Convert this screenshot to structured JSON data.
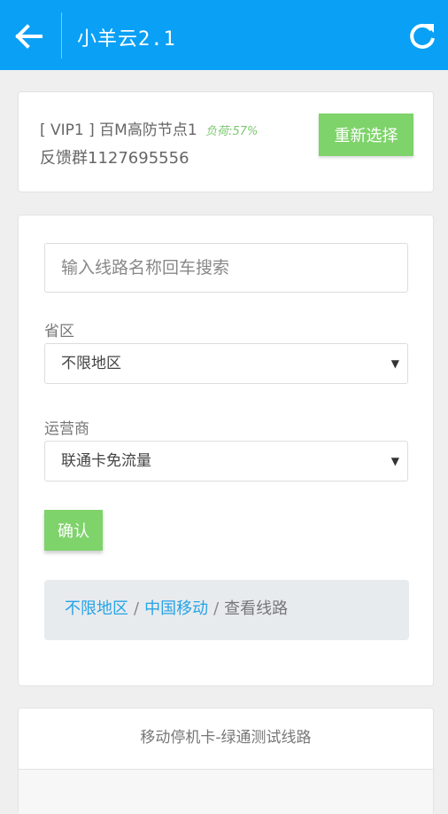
{
  "header": {
    "title": "小羊云2.1",
    "back_icon": "arrow-left-icon",
    "refresh_icon": "refresh-icon",
    "color": "#0aa0f5"
  },
  "node_card": {
    "node_name": "[ VIP1 ] 百M高防节点1",
    "load_text": "负荷:57%",
    "feedback": "反馈群1127695556",
    "reselect_label": "重新选择"
  },
  "filter": {
    "search_placeholder": "输入线路名称回车搜索",
    "province_label": "省区",
    "province_value": "不限地区",
    "carrier_label": "运营商",
    "carrier_value": "联通卡免流量",
    "confirm_label": "确认"
  },
  "breadcrumb": {
    "region": "不限地区",
    "carrier": "中国移动",
    "current": "查看线路",
    "separator": "/"
  },
  "list": {
    "title": "移动停机卡-绿通测试线路"
  },
  "colors": {
    "accent_green": "#7ed36a",
    "link_blue": "#26a3e6"
  }
}
